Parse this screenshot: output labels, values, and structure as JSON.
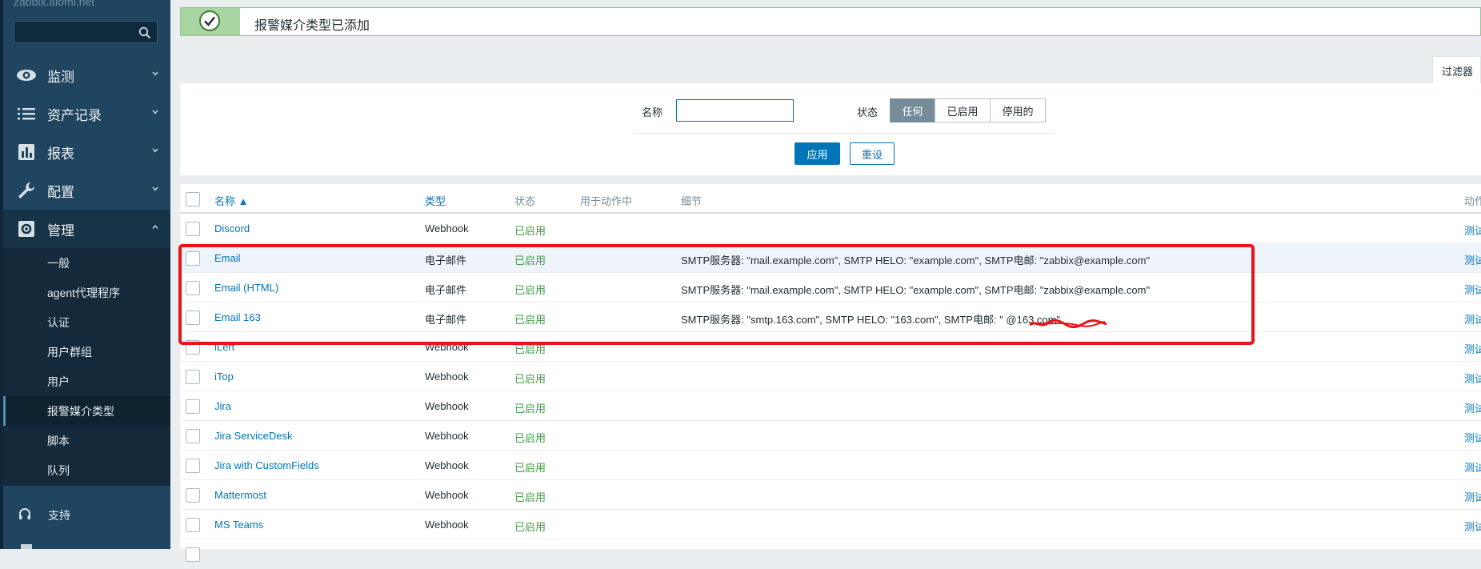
{
  "sidebar": {
    "brand": "zabbix.aiomi.net",
    "search_placeholder": "",
    "menu": [
      {
        "label": "监测",
        "icon": "eye-icon"
      },
      {
        "label": "资产记录",
        "icon": "list-icon"
      },
      {
        "label": "报表",
        "icon": "bar-chart-icon"
      },
      {
        "label": "配置",
        "icon": "wrench-icon"
      },
      {
        "label": "管理",
        "icon": "gear-icon"
      }
    ],
    "submenu": [
      "一般",
      "agent代理程序",
      "认证",
      "用户群组",
      "用户",
      "报警媒介类型",
      "脚本",
      "队列"
    ],
    "support": "支持"
  },
  "notice": {
    "message": "报警媒介类型已添加"
  },
  "filter": {
    "tab": "过滤器",
    "name_label": "名称",
    "name_value": "",
    "status_label": "状态",
    "status_options": [
      "任何",
      "已启用",
      "停用的"
    ],
    "apply": "应用",
    "reset": "重设"
  },
  "table": {
    "headers": {
      "name": "名称 ▲",
      "type": "类型",
      "status": "状态",
      "used": "用于动作中",
      "details": "细节",
      "action": "动作"
    },
    "rows": [
      {
        "name": "Discord",
        "type": "Webhook",
        "status": "已启用",
        "details": "",
        "action": "测试"
      },
      {
        "name": "Email",
        "type": "电子邮件",
        "status": "已启用",
        "details": "SMTP服务器: \"mail.example.com\", SMTP HELO: \"example.com\", SMTP电邮: \"zabbix@example.com\"",
        "action": "测试"
      },
      {
        "name": "Email (HTML)",
        "type": "电子邮件",
        "status": "已启用",
        "details": "SMTP服务器: \"mail.example.com\", SMTP HELO: \"example.com\", SMTP电邮: \"zabbix@example.com\"",
        "action": "测试"
      },
      {
        "name": "Email 163",
        "type": "电子邮件",
        "status": "已启用",
        "details": "SMTP服务器: \"smtp.163.com\", SMTP HELO: \"163.com\", SMTP电邮: \"                   @163.com\"",
        "action": "测试"
      },
      {
        "name": "iLert",
        "type": "Webhook",
        "status": "已启用",
        "details": "",
        "action": "测试"
      },
      {
        "name": "iTop",
        "type": "Webhook",
        "status": "已启用",
        "details": "",
        "action": "测试"
      },
      {
        "name": "Jira",
        "type": "Webhook",
        "status": "已启用",
        "details": "",
        "action": "测试"
      },
      {
        "name": "Jira ServiceDesk",
        "type": "Webhook",
        "status": "已启用",
        "details": "",
        "action": "测试"
      },
      {
        "name": "Jira with CustomFields",
        "type": "Webhook",
        "status": "已启用",
        "details": "",
        "action": "测试"
      },
      {
        "name": "Mattermost",
        "type": "Webhook",
        "status": "已启用",
        "details": "",
        "action": "测试"
      },
      {
        "name": "MS Teams",
        "type": "Webhook",
        "status": "已启用",
        "details": "",
        "action": "测试"
      }
    ]
  }
}
